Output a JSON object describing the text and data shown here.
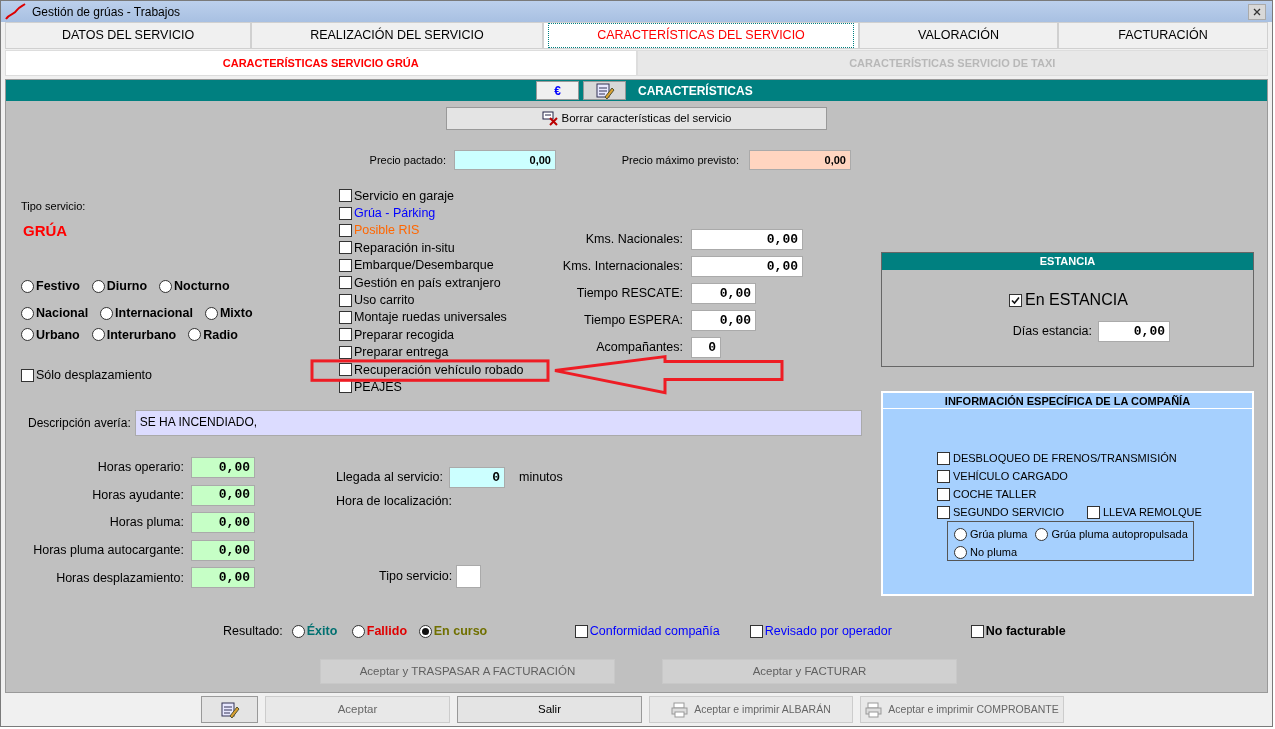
{
  "window": {
    "title": "Gestión de grúas - Trabajos"
  },
  "tabs": [
    {
      "label": "DATOS DEL SERVICIO",
      "selected": false
    },
    {
      "label": "REALIZACIÓN DEL SERVICIO",
      "selected": false
    },
    {
      "label": "CARACTERÍSTICAS DEL SERVICIO",
      "selected": true
    },
    {
      "label": "VALORACIÓN",
      "selected": false
    },
    {
      "label": "FACTURACIÓN",
      "selected": false
    }
  ],
  "subtabs": [
    {
      "label": "CARACTERÍSTICAS SERVICIO GRÚA",
      "selected": true
    },
    {
      "label": "CARACTERÍSTICAS SERVICIO DE TAXI",
      "selected": false
    }
  ],
  "section_bar": {
    "currency_button": "€",
    "title": "CARACTERÍSTICAS"
  },
  "clear_button": "Borrar características del servicio",
  "prices": [
    {
      "label": "Precio pactado:",
      "value": "0,00",
      "color": "#ccffff"
    },
    {
      "label": "Precio máximo previsto:",
      "value": "0,00",
      "color": "#ffd5c0"
    }
  ],
  "service_type": {
    "label": "Tipo servicio:",
    "value": "GRÚA"
  },
  "radio_rows": [
    {
      "options": [
        {
          "label": "Festivo",
          "selected": false
        },
        {
          "label": "Diurno",
          "selected": false
        },
        {
          "label": "Nocturno",
          "selected": false
        }
      ]
    },
    {
      "options": [
        {
          "label": "Nacional",
          "selected": false
        },
        {
          "label": "Internacional",
          "selected": false
        },
        {
          "label": "Mixto",
          "selected": false
        }
      ]
    },
    {
      "options": [
        {
          "label": "Urbano",
          "selected": false
        },
        {
          "label": "Interurbano",
          "selected": false
        },
        {
          "label": "Radio",
          "selected": false
        }
      ]
    }
  ],
  "only_travel": {
    "label": "Sólo desplazamiento",
    "checked": false
  },
  "options": [
    {
      "label": "Servicio en garaje",
      "checked": false,
      "color": "#000000"
    },
    {
      "label": "Grúa - Párking",
      "checked": false,
      "color": "#0000ff"
    },
    {
      "label": "Posible RIS",
      "checked": false,
      "color": "#ff6600"
    },
    {
      "label": "Reparación in-situ",
      "checked": false,
      "color": "#000000"
    },
    {
      "label": "Embarque/Desembarque",
      "checked": false,
      "color": "#000000"
    },
    {
      "label": "Gestión en país extranjero",
      "checked": false,
      "color": "#000000"
    },
    {
      "label": "Uso carrito",
      "checked": false,
      "color": "#000000"
    },
    {
      "label": "Montaje ruedas universales",
      "checked": false,
      "color": "#000000"
    },
    {
      "label": "Preparar recogida",
      "checked": false,
      "color": "#000000"
    },
    {
      "label": "Preparar entrega",
      "checked": false,
      "color": "#000000"
    },
    {
      "label": "Recuperación vehículo robado",
      "checked": false,
      "color": "#000000"
    },
    {
      "label": "PEAJES",
      "checked": false,
      "color": "#000000"
    }
  ],
  "measures": [
    {
      "label": "Kms. Nacionales:",
      "value": "0,00",
      "kind": "distance"
    },
    {
      "label": "Kms. Internacionales:",
      "value": "0,00",
      "kind": "distance"
    },
    {
      "label": "Tiempo RESCATE:",
      "value": "0,00",
      "kind": "time"
    },
    {
      "label": "Tiempo ESPERA:",
      "value": "0,00",
      "kind": "time"
    },
    {
      "label": "Acompañantes:",
      "value": "0",
      "kind": "count"
    }
  ],
  "stay": {
    "title": "ESTANCIA",
    "in_stay": {
      "label": "En ESTANCIA",
      "checked": true
    },
    "days": {
      "label": "Días estancia:",
      "value": "0,00"
    }
  },
  "description": {
    "label": "Descripción avería:",
    "value": "SE HA INCENDIADO,"
  },
  "hours": [
    {
      "label": "Horas operario:",
      "value": "0,00"
    },
    {
      "label": "Horas ayudante:",
      "value": "0,00"
    },
    {
      "label": "Horas pluma:",
      "value": "0,00"
    },
    {
      "label": "Horas pluma autocargante:",
      "value": "0,00"
    },
    {
      "label": "Horas desplazamiento:",
      "value": "0,00"
    }
  ],
  "arrival": {
    "label": "Llegada al servicio:",
    "value": "0",
    "unit": "minutos"
  },
  "location_time": {
    "label": "Hora de localización:"
  },
  "service_type_field": {
    "label": "Tipo servicio:"
  },
  "company_info": {
    "title": "INFORMACIÓN ESPECÍFICA DE LA COMPAÑÍA",
    "checks": [
      {
        "label": "DESBLOQUEO DE FRENOS/TRANSMISIÓN",
        "checked": false
      },
      {
        "label": "VEHÍCULO CARGADO",
        "checked": false
      },
      {
        "label": "COCHE TALLER",
        "checked": false
      },
      {
        "label": "SEGUNDO SERVICIO",
        "checked": false
      },
      {
        "label": "LLEVA REMOLQUE",
        "checked": false
      }
    ],
    "crane_types": [
      {
        "label": "Grúa pluma",
        "selected": false
      },
      {
        "label": "Grúa pluma autopropulsada",
        "selected": false
      },
      {
        "label": "No pluma",
        "selected": false
      }
    ]
  },
  "result": {
    "label": "Resultado:",
    "options": [
      {
        "label": "Éxito",
        "selected": false,
        "color": "#007070"
      },
      {
        "label": "Fallido",
        "selected": false,
        "color": "#e00000"
      },
      {
        "label": "En curso",
        "selected": true,
        "color": "#707000"
      }
    ]
  },
  "flags": [
    {
      "label": "Conformidad compañía",
      "checked": false,
      "kind": "link"
    },
    {
      "label": "Revisado por operador",
      "checked": false,
      "kind": "link"
    },
    {
      "label": "No facturable",
      "checked": false,
      "kind": "strong"
    }
  ],
  "action_buttons": [
    {
      "label": "Aceptar y TRASPASAR A FACTURACIÓN",
      "disabled": true
    },
    {
      "label": "Aceptar y FACTURAR",
      "disabled": true
    }
  ],
  "footer_buttons": [
    {
      "kind": "notepad",
      "disabled": false
    },
    {
      "kind": "text",
      "label": "Aceptar",
      "disabled": true
    },
    {
      "kind": "text",
      "label": "Salir",
      "disabled": false
    },
    {
      "kind": "print",
      "label": "Aceptar e imprimir ALBARÁN",
      "disabled": true
    },
    {
      "kind": "print",
      "label": "Aceptar e imprimir COMPROBANTE",
      "disabled": true
    }
  ]
}
